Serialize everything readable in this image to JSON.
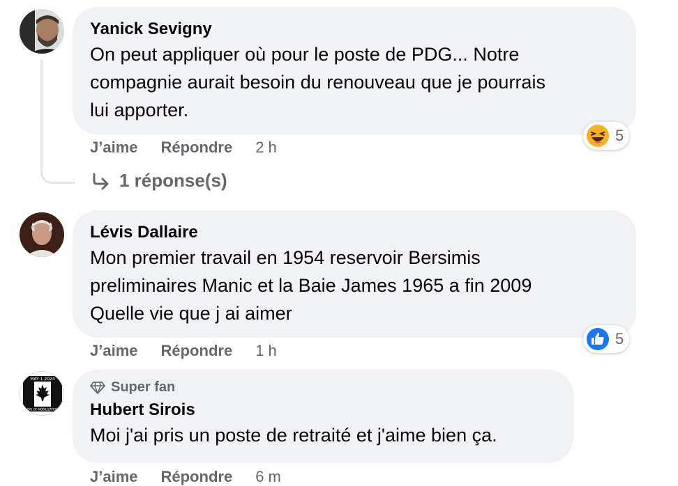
{
  "comments": [
    {
      "author": "Yanick Sevigny",
      "lines": [
        "On peut appliquer où pour le poste de PDG... Notre",
        "compagnie aurait besoin du renouveau que je pourrais",
        "lui apporter."
      ],
      "like_label": "J’aime",
      "reply_label": "Répondre",
      "time": "2 h",
      "reaction_icon": "laughing-emoji-icon",
      "reaction_count": "5",
      "replies_label": "1 réponse(s)"
    },
    {
      "author": "Lévis Dallaire",
      "lines": [
        "Mon premier travail en 1954 reservoir Bersimis",
        "preliminaires Manic et la Baie James 1965 a fin 2009",
        "Quelle vie que j ai aimer"
      ],
      "like_label": "J’aime",
      "reply_label": "Répondre",
      "time": "1 h",
      "reaction_icon": "thumbs-up-icon",
      "reaction_count": "5"
    },
    {
      "badge": "Super fan",
      "badge_icon": "diamond-icon",
      "author": "Hubert Sirois",
      "lines": [
        "Moi j'ai pris un poste de retraité et j'aime bien ça."
      ],
      "like_label": "J’aime",
      "reply_label": "Répondre",
      "time": "6 m",
      "avatar_text": "MAY 1 2024",
      "avatar_text_bottom": "DAY OF MOBILIZATION"
    }
  ],
  "colors": {
    "bubble": "#f0f2f5",
    "secondary_text": "#65676b",
    "like_blue": "#1877f2",
    "laugh_yellow": "#f7b125"
  }
}
